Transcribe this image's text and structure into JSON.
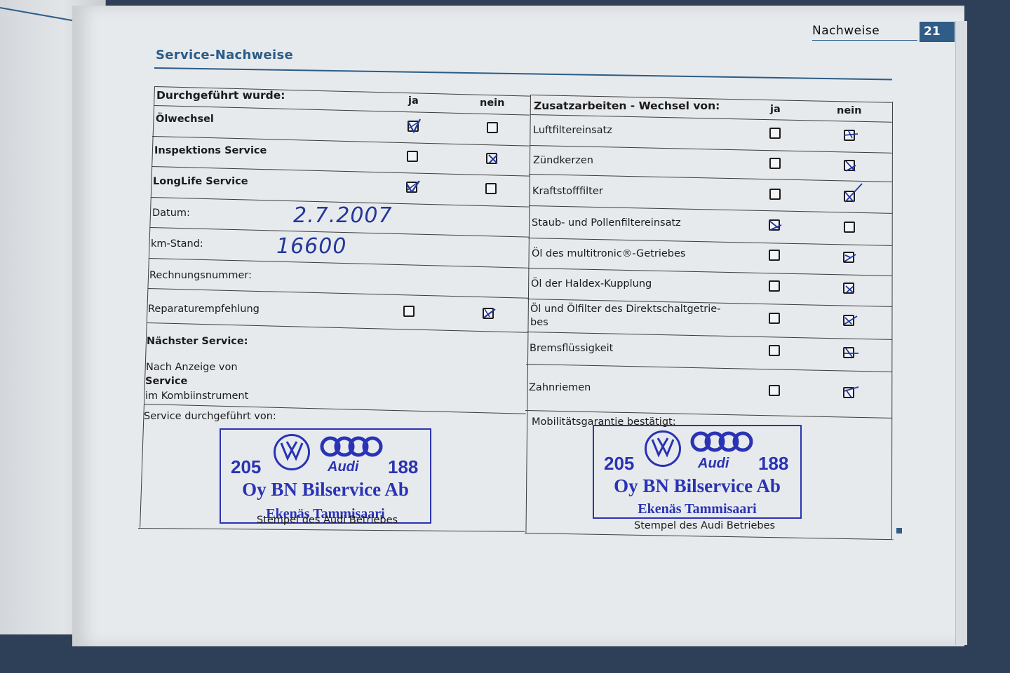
{
  "header": {
    "section": "Nachweise",
    "page_number": "21"
  },
  "title": "Service-Nachweise",
  "left_table": {
    "heading": "Durchgeführt wurde:",
    "col_yes": "ja",
    "col_no": "nein",
    "rows": [
      {
        "label": "Ölwechsel",
        "yes": "checked",
        "no": "empty"
      },
      {
        "label": "Inspektions Service",
        "yes": "empty",
        "no": "checked"
      },
      {
        "label": "LongLife Service",
        "yes": "checked",
        "no": "empty"
      }
    ],
    "date_label": "Datum:",
    "date_value": "2.7.2007",
    "km_label": "km-Stand:",
    "km_value": "16600",
    "invoice_label": "Rechnungsnummer:",
    "repair_label": "Reparaturempfehlung",
    "repair_yes": "empty",
    "repair_no": "checked",
    "next_service_label": "Nächster Service:",
    "next_service_line1": "Nach Anzeige von",
    "next_service_line2": "Service",
    "next_service_line3": "im Kombiinstrument",
    "performed_by_label": "Service durchgeführt von:"
  },
  "right_table": {
    "heading": "Zusatzarbeiten - Wechsel von:",
    "col_yes": "ja",
    "col_no": "nein",
    "rows": [
      {
        "label": "Luftfiltereinsatz",
        "yes": "empty",
        "no": "checked"
      },
      {
        "label": "Zündkerzen",
        "yes": "empty",
        "no": "checked"
      },
      {
        "label": "Kraftstofffilter",
        "yes": "empty",
        "no": "checked"
      },
      {
        "label": "Staub- und Pollenfiltereinsatz",
        "yes": "checked",
        "no": "empty"
      },
      {
        "label": "Öl des multitronic®-Getriebes",
        "yes": "empty",
        "no": "checked"
      },
      {
        "label": "Öl der Haldex-Kupplung",
        "yes": "empty",
        "no": "checked"
      },
      {
        "label": "Öl und Ölfilter des Direktschaltgetrie-",
        "label_cont": "bes",
        "yes": "empty",
        "no": "checked"
      },
      {
        "label": "Bremsflüssigkeit",
        "yes": "empty",
        "no": "checked"
      },
      {
        "label": "Zahnriemen",
        "yes": "empty",
        "no": "checked"
      }
    ],
    "mobility_label": "Mobilitätsgarantie bestätigt:"
  },
  "stamp": {
    "number_left": "205",
    "number_right": "188",
    "brand": "Audi",
    "company": "Oy BN Bilservice Ab",
    "city": "Ekenäs Tammisaari"
  },
  "stamp_caption": "Stempel des Audi Betriebes",
  "colors": {
    "accent": "#2f5d86",
    "ink": "#23379a",
    "stamp": "#2a33b5"
  }
}
